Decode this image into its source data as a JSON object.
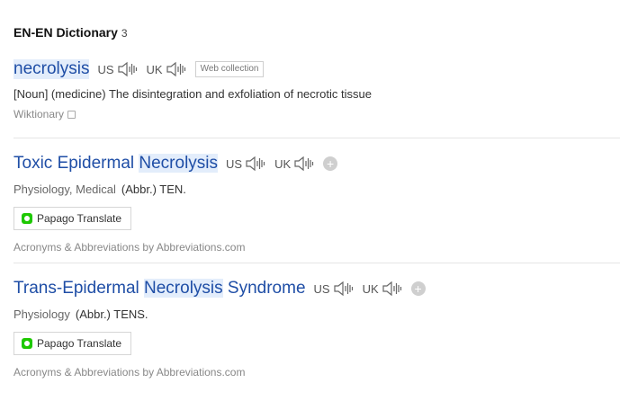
{
  "section": {
    "title": "EN-EN Dictionary",
    "count": "3"
  },
  "entries": [
    {
      "word": "necrolysis",
      "pron_us": "US",
      "pron_uk": "UK",
      "badge": "Web collection",
      "definition": "[Noun] (medicine) The disintegration and exfoliation of necrotic tissue",
      "source": "Wiktionary"
    },
    {
      "word_pre": "Toxic Epidermal ",
      "word_hl": "Necrolysis",
      "word_post": "",
      "pron_us": "US",
      "pron_uk": "UK",
      "fields": "Physiology, Medical",
      "abbr": "(Abbr.) TEN.",
      "translate": "Papago Translate",
      "source": "Acronyms & Abbreviations by Abbreviations.com"
    },
    {
      "word_pre": "Trans-Epidermal ",
      "word_hl": "Necrolysis",
      "word_post": " Syndrome",
      "pron_us": "US",
      "pron_uk": "UK",
      "fields": "Physiology",
      "abbr": "(Abbr.) TENS.",
      "translate": "Papago Translate",
      "source": "Acronyms & Abbreviations by Abbreviations.com"
    }
  ],
  "icons": {
    "speaker": "speaker-icon",
    "add": "add-icon",
    "external": "external-link-icon",
    "papago": "papago-logo-icon"
  },
  "colors": {
    "link": "#1f4ea6",
    "highlight": "#e3edfb",
    "papago": "#1ec800"
  }
}
